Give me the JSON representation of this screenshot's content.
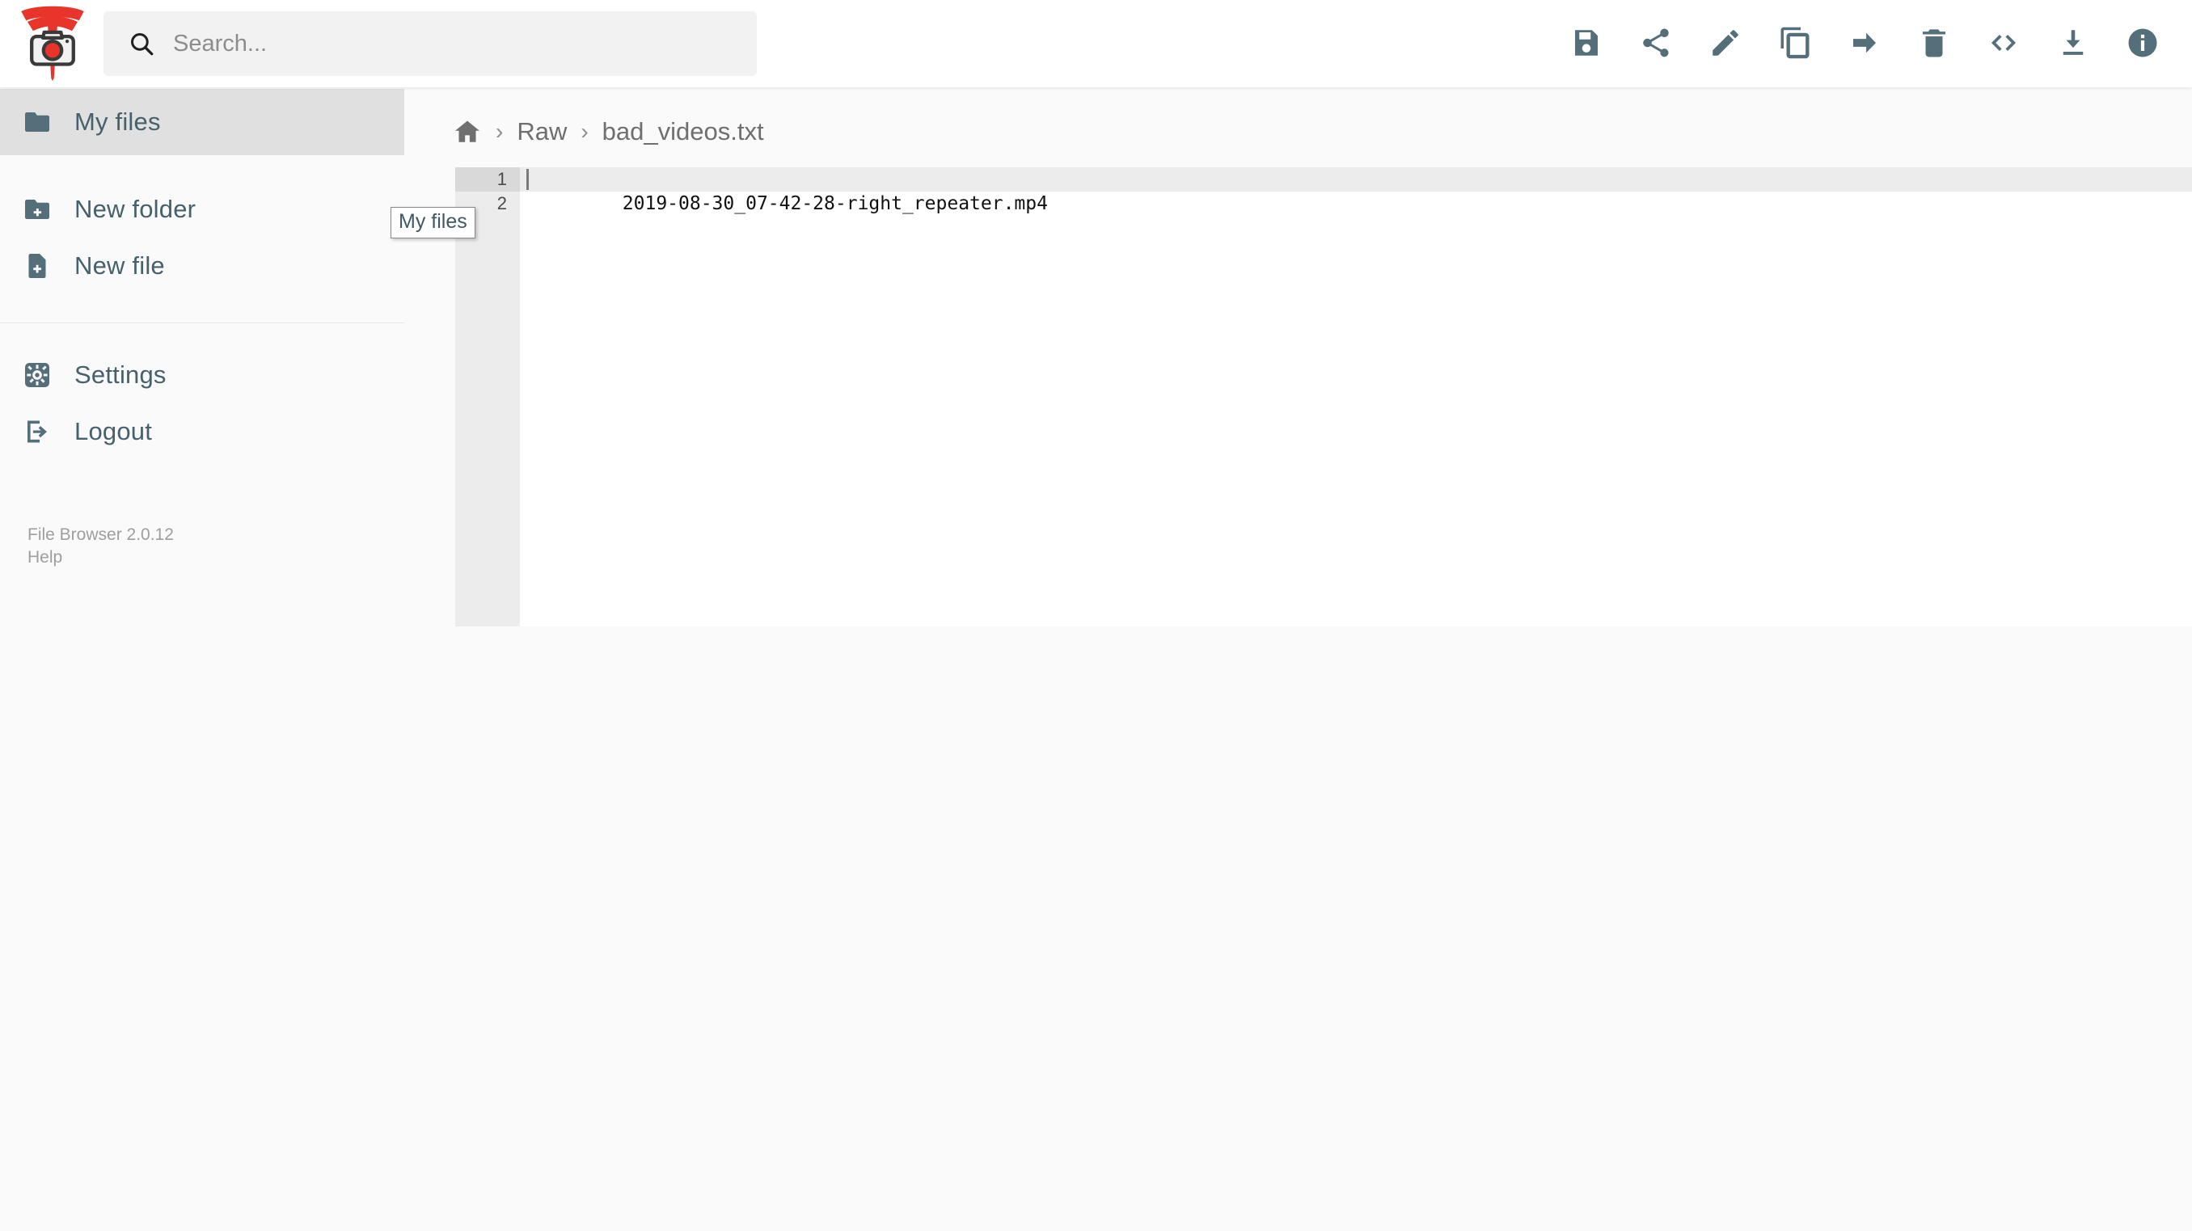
{
  "app": {
    "logo_name": "tesla-dashcam-logo",
    "accent_color": "#e8342a",
    "icon_color": "#546e7a"
  },
  "header": {
    "search": {
      "placeholder": "Search...",
      "value": "",
      "icon": "search-icon"
    },
    "toolbar": [
      {
        "name": "save",
        "icon": "save-icon",
        "label": "Save"
      },
      {
        "name": "share",
        "icon": "share-icon",
        "label": "Share"
      },
      {
        "name": "rename",
        "icon": "pencil-icon",
        "label": "Rename"
      },
      {
        "name": "copy",
        "icon": "copy-icon",
        "label": "Copy"
      },
      {
        "name": "move",
        "icon": "arrow-right-icon",
        "label": "Move"
      },
      {
        "name": "delete",
        "icon": "trash-icon",
        "label": "Delete"
      },
      {
        "name": "source",
        "icon": "code-brackets-icon",
        "label": "Toggle source"
      },
      {
        "name": "download",
        "icon": "download-icon",
        "label": "Download"
      },
      {
        "name": "info",
        "icon": "info-circle-icon",
        "label": "Info"
      }
    ]
  },
  "sidebar": {
    "items": [
      {
        "label": "My files",
        "icon": "folder-icon",
        "active": true
      },
      {
        "label": "New folder",
        "icon": "folder-plus-icon",
        "active": false
      },
      {
        "label": "New file",
        "icon": "file-plus-icon",
        "active": false
      },
      {
        "label": "Settings",
        "icon": "gear-icon",
        "active": false
      },
      {
        "label": "Logout",
        "icon": "logout-icon",
        "active": false
      }
    ],
    "footer": {
      "version": "File Browser 2.0.12",
      "help": "Help"
    }
  },
  "tooltip": {
    "text": "My files",
    "visible": true
  },
  "main": {
    "breadcrumb": {
      "home_icon": "home-icon",
      "separator": "›",
      "crumbs": [
        "Raw",
        "bad_videos.txt"
      ]
    },
    "editor": {
      "filename": "bad_videos.txt",
      "line_numbers": [
        "1",
        "2"
      ],
      "lines": [
        "2019-08-30_07-42-28-right_repeater.mp4",
        ""
      ],
      "active_line": 1,
      "cursor_line": 1,
      "cursor_column": 1
    }
  }
}
